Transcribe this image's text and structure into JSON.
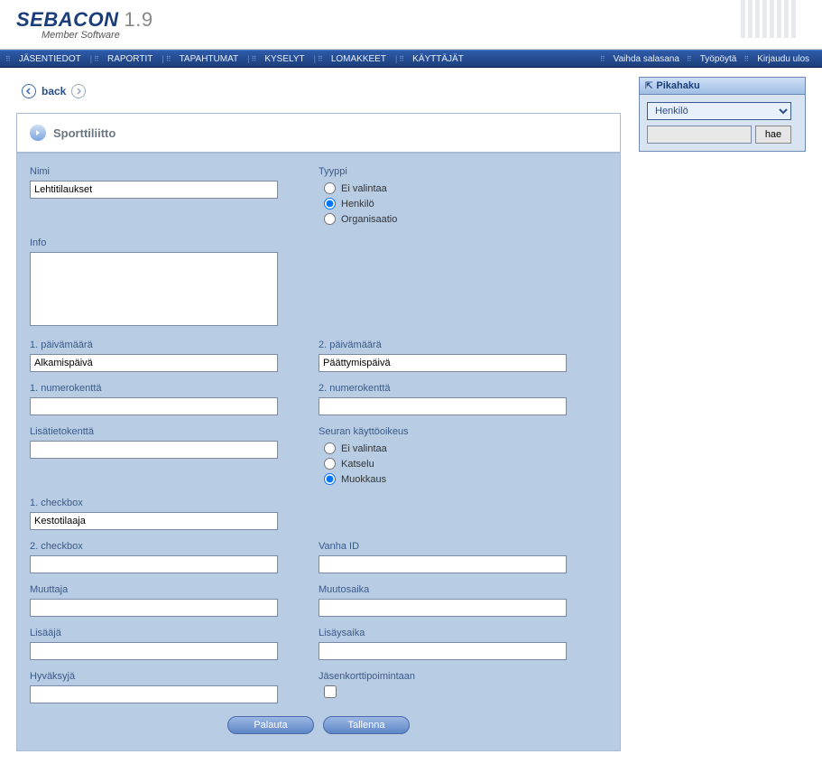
{
  "brand": {
    "name": "SEBACON",
    "version": "1.9",
    "tagline": "Member Software"
  },
  "nav": {
    "left": [
      "JÄSENTIEDOT",
      "RAPORTIT",
      "TAPAHTUMAT",
      "KYSELYT",
      "LOMAKKEET",
      "KÄYTTÄJÄT"
    ],
    "right": [
      "Vaihda salasana",
      "Työpöytä",
      "Kirjaudu ulos"
    ]
  },
  "back": {
    "label": "back"
  },
  "page_title": "Sporttiliitto",
  "form": {
    "nimi": {
      "label": "Nimi",
      "value": "Lehtitilaukset"
    },
    "tyyppi": {
      "label": "Tyyppi",
      "options": [
        "Ei valintaa",
        "Henkilö",
        "Organisaatio"
      ],
      "selected": "Henkilö"
    },
    "info": {
      "label": "Info",
      "value": ""
    },
    "pvm1": {
      "label": "1. päivämäärä",
      "value": "Alkamispäivä"
    },
    "pvm2": {
      "label": "2. päivämäärä",
      "value": "Päättymispäivä"
    },
    "num1": {
      "label": "1. numerokenttä",
      "value": ""
    },
    "num2": {
      "label": "2. numerokenttä",
      "value": ""
    },
    "lisatieto": {
      "label": "Lisätietokenttä",
      "value": ""
    },
    "oikeus": {
      "label": "Seuran käyttöoikeus",
      "options": [
        "Ei valintaa",
        "Katselu",
        "Muokkaus"
      ],
      "selected": "Muokkaus"
    },
    "cb1": {
      "label": "1. checkbox",
      "value": "Kestotilaaja"
    },
    "cb2": {
      "label": "2. checkbox",
      "value": ""
    },
    "vanha_id": {
      "label": "Vanha ID",
      "value": ""
    },
    "muuttaja": {
      "label": "Muuttaja",
      "value": ""
    },
    "muutosaika": {
      "label": "Muutosaika",
      "value": ""
    },
    "lisaaja": {
      "label": "Lisääjä",
      "value": ""
    },
    "lisaysaika": {
      "label": "Lisäysaika",
      "value": ""
    },
    "hyvaksyja": {
      "label": "Hyväksyjä",
      "value": ""
    },
    "jasenkortti": {
      "label": "Jäsenkorttipoimintaan",
      "checked": false
    }
  },
  "buttons": {
    "palauta": "Palauta",
    "tallenna": "Tallenna"
  },
  "quick": {
    "title": "Pikahaku",
    "select_value": "Henkilö",
    "search_value": "",
    "search_button": "hae"
  }
}
